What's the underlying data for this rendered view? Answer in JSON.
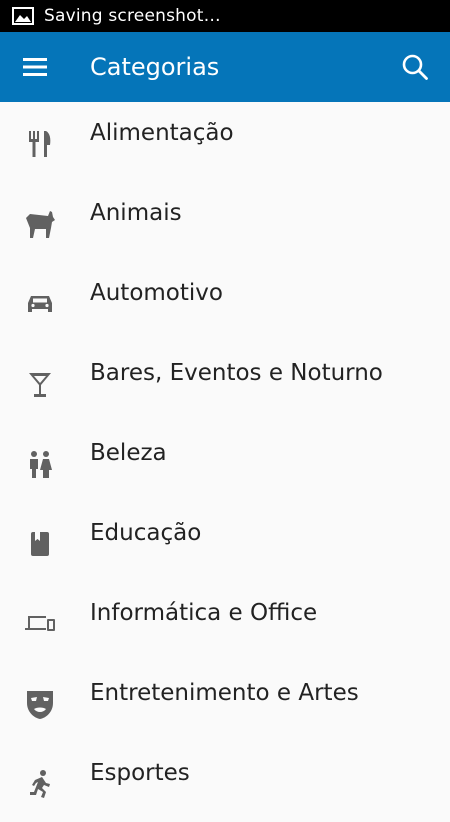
{
  "status_bar": {
    "text": "Saving screenshot…"
  },
  "app_bar": {
    "title": "Categorias",
    "menu_icon": "hamburger-menu-icon",
    "search_icon": "search-icon",
    "color": "#0575b9"
  },
  "categories": [
    {
      "label": "Alimentação",
      "icon": "fork-knife-icon"
    },
    {
      "label": "Animais",
      "icon": "dog-icon"
    },
    {
      "label": "Automotivo",
      "icon": "car-icon"
    },
    {
      "label": "Bares, Eventos e Noturno",
      "icon": "cocktail-glass-icon"
    },
    {
      "label": "Beleza",
      "icon": "people-icon"
    },
    {
      "label": "Educação",
      "icon": "book-icon"
    },
    {
      "label": "Informática e Office",
      "icon": "devices-icon"
    },
    {
      "label": "Entretenimento e Artes",
      "icon": "theater-mask-icon"
    },
    {
      "label": "Esportes",
      "icon": "running-person-icon"
    }
  ]
}
